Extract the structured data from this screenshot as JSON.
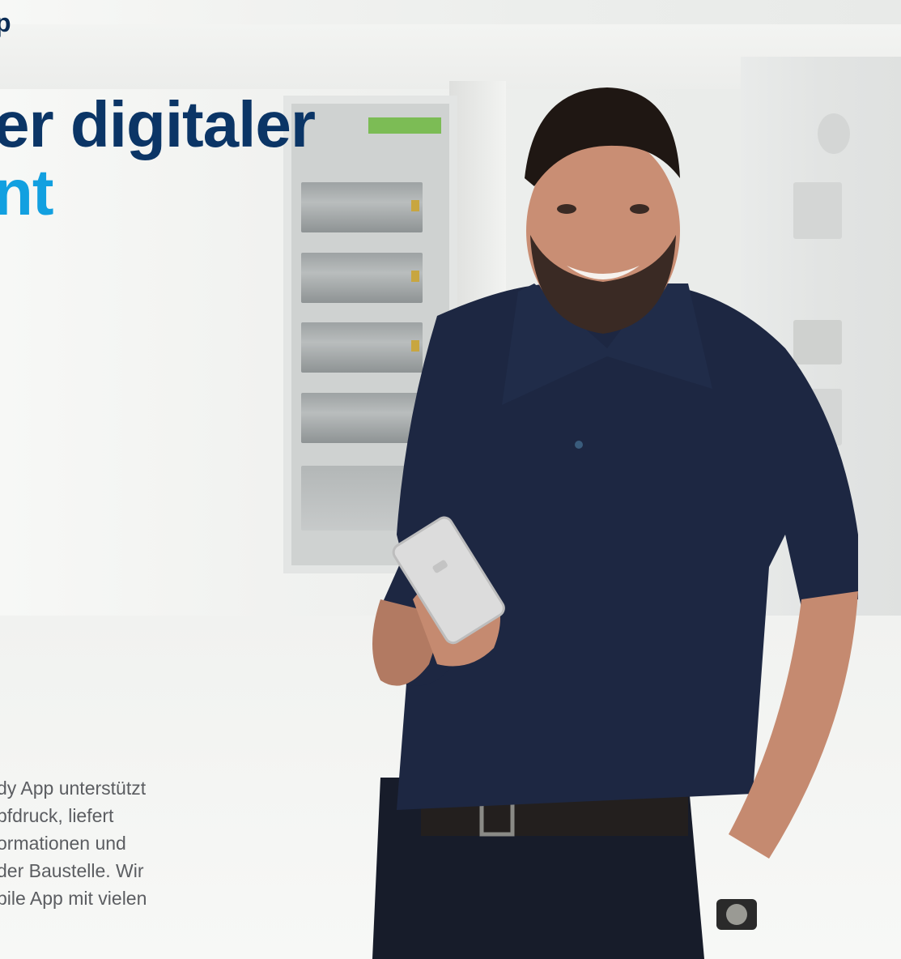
{
  "header": {
    "eyebrow": "p",
    "headline_line1": "er digitaler",
    "headline_line2": "nt"
  },
  "body": {
    "lines": [
      "dy App unterstützt",
      "pfdruck, liefert",
      "ormationen und",
      "der Baustelle. Wir",
      "bile App mit vielen"
    ]
  },
  "colors": {
    "headline_dark": "#0b3566",
    "headline_accent": "#12a0e0",
    "body": "#5b5d61",
    "shirt": "#1d2742"
  },
  "image": {
    "subject": "smiling-technician-holding-smartphone-icon"
  }
}
